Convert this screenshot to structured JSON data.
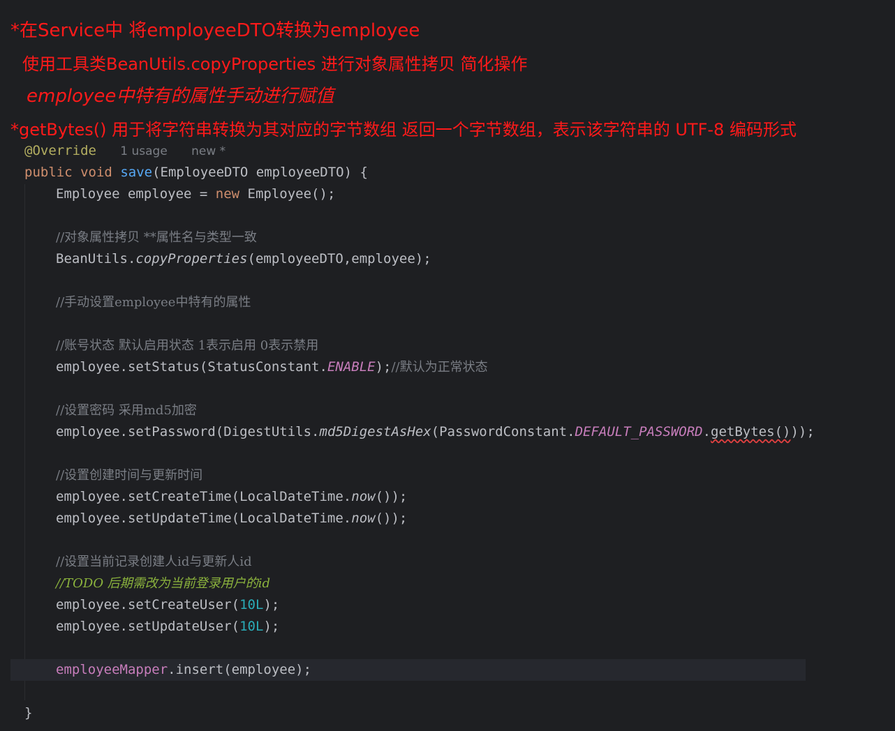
{
  "notes": {
    "line1": "*在Service中 将employeeDTO转换为employee",
    "line2": "使用工具类BeanUtils.copyProperties 进行对象属性拷贝 简化操作",
    "line3": "employee中特有的属性手动进行赋值",
    "line4": "*getBytes() 用于将字符串转换为其对应的字节数组 返回一个字节数组，表示该字符串的 UTF-8 编码形式"
  },
  "code": {
    "annotation": "@Override",
    "usage_hint": "1 usage",
    "new_hint": "new *",
    "signature": {
      "mod": "public",
      "ret": "void",
      "name": "save",
      "params": "(EmployeeDTO employeeDTO) {"
    },
    "l_new_emp": {
      "pre": "Employee employee = ",
      "kw": "new",
      "post": " Employee();"
    },
    "c_copy": "//对象属性拷贝 **属性名与类型一致",
    "l_copy": {
      "pre": "BeanUtils.",
      "method": "copyProperties",
      "post": "(employeeDTO,employee);"
    },
    "c_manual": "//手动设置employee中特有的属性",
    "c_status": "//账号状态 默认启用状态 1表示启用 0表示禁用",
    "l_status": {
      "pre": "employee.setStatus(StatusConstant.",
      "const": "ENABLE",
      "post": ");",
      "cmt": "//默认为正常状态"
    },
    "c_pwd": "//设置密码 采用md5加密",
    "l_pwd": {
      "pre": "employee.setPassword(DigestUtils.",
      "method": "md5DigestAsHex",
      "mid": "(PasswordConstant.",
      "const": "DEFAULT_PASSWORD",
      "dot": ".",
      "warn": "getBytes()",
      "post": "));"
    },
    "c_time": "//设置创建时间与更新时间",
    "l_ctime": {
      "pre": "employee.setCreateTime(LocalDateTime.",
      "method": "now",
      "post": "());"
    },
    "l_utime": {
      "pre": "employee.setUpdateTime(LocalDateTime.",
      "method": "now",
      "post": "());"
    },
    "c_user": "//设置当前记录创建人id与更新人id",
    "c_todo": "//TODO 后期需改为当前登录用户的id",
    "l_cuser": {
      "pre": "employee.setCreateUser(",
      "num": "10L",
      "post": ");"
    },
    "l_uuser": {
      "pre": "employee.setUpdateUser(",
      "num": "10L",
      "post": ");"
    },
    "l_insert": {
      "field": "employeeMapper",
      "post": ".insert(employee);"
    },
    "close": "}"
  }
}
